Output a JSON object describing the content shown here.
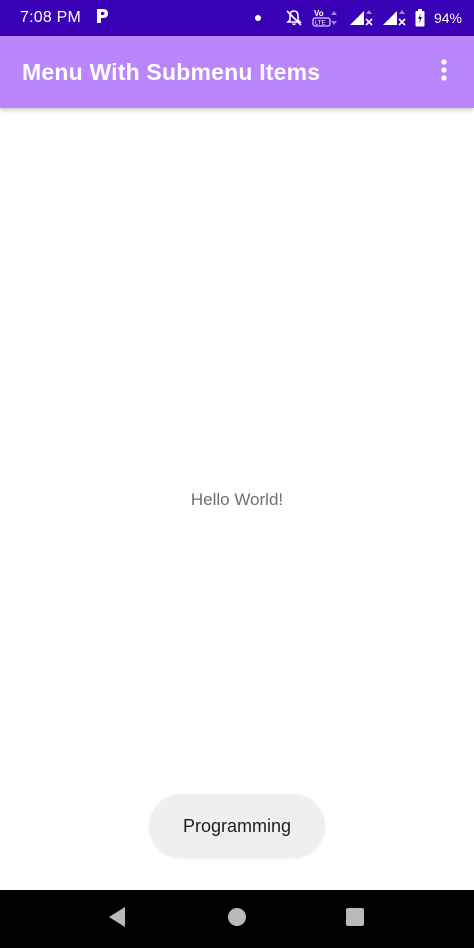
{
  "status_bar": {
    "time": "7:08 PM",
    "notification_icon": "p-app-icon",
    "dot_icon": "notification-dot-icon",
    "battery_percent": "94%",
    "icons": [
      "muted-bell-icon",
      "volte-icon",
      "signal-icon",
      "signal-icon",
      "battery-icon"
    ]
  },
  "app_bar": {
    "title": "Menu With Submenu Items",
    "overflow_icon": "more-vert-icon"
  },
  "main": {
    "hello_text": "Hello World!"
  },
  "toast": {
    "text": "Programming"
  },
  "navigation": {
    "back_icon": "back-triangle-icon",
    "home_icon": "home-circle-icon",
    "recents_icon": "recents-square-icon"
  },
  "colors": {
    "status_bar": "#3a00b6",
    "app_bar": "#bb86fc",
    "toast_bg": "#efefef",
    "nav_bar": "#000000"
  }
}
